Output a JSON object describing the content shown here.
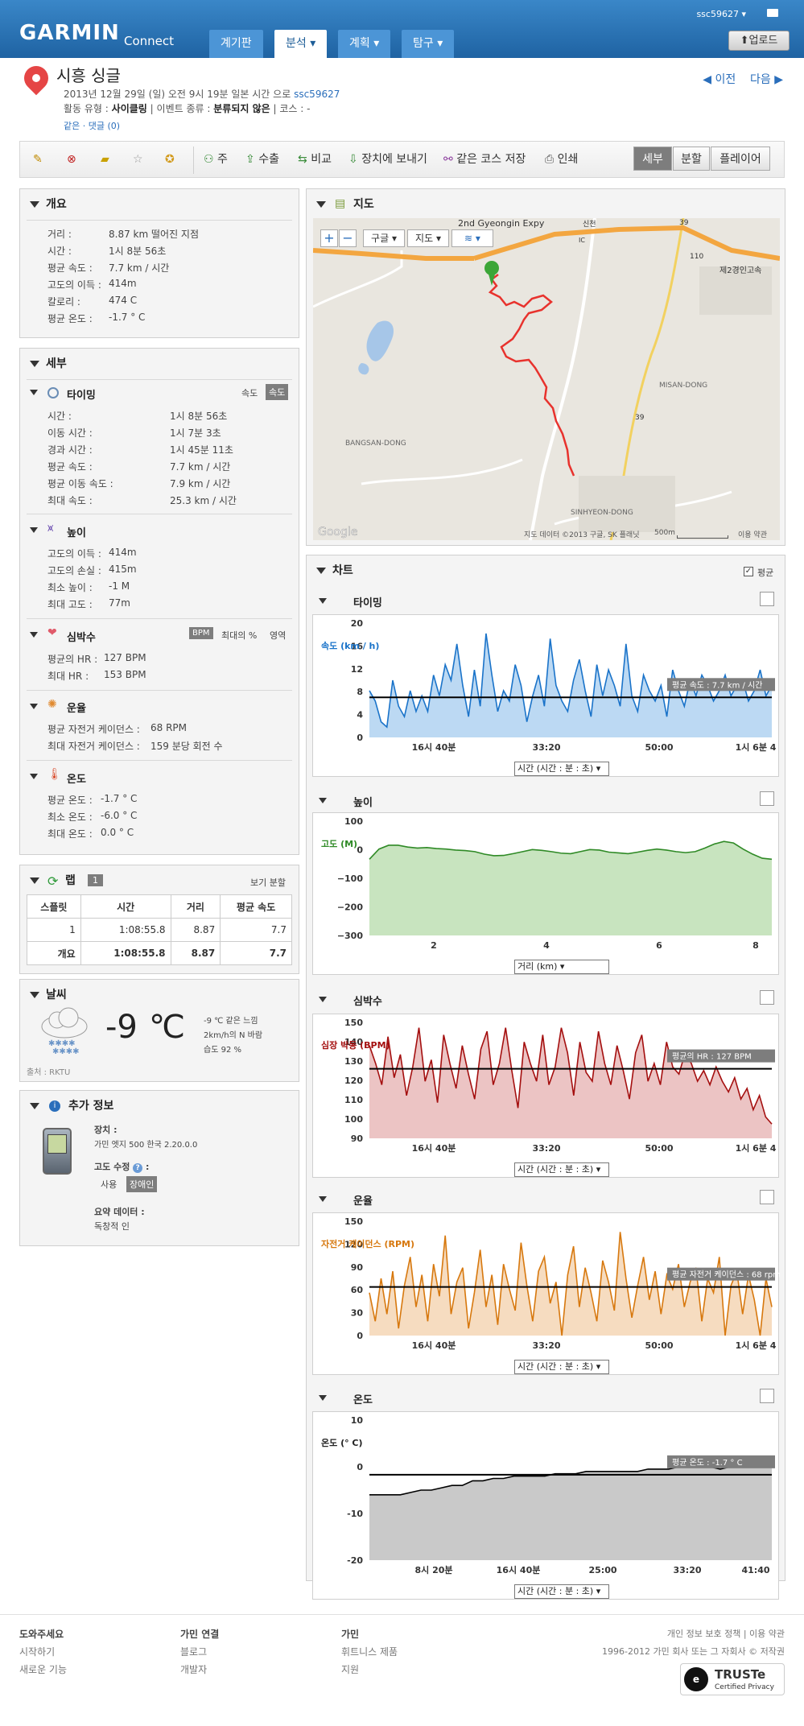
{
  "header": {
    "brand": "GARMIN",
    "brand_sub": "Connect",
    "username": "ssc59627",
    "tabs": [
      "계기판",
      "분석",
      "계획",
      "탐구"
    ],
    "upload_label": "업로드"
  },
  "activity": {
    "title": "시흥 싱글",
    "date_text": "2013년 12월 29일 (일) 오전 9시 19분 일본 시간 으로",
    "owner": "ssc59627",
    "type_label": "활동 유형 :",
    "type_value": "사이클링",
    "event_label": "| 이벤트 종류 :",
    "event_value": "분류되지 않은",
    "course_label": "| 코스 : -",
    "links": "같은 · 댓글 (0)",
    "prev": "이전",
    "next": "다음"
  },
  "toolbar": {
    "items": [
      "주",
      "수출",
      "비교",
      "장치에 보내기",
      "같은 코스 저장",
      "인쇄"
    ],
    "views": [
      "세부",
      "분할",
      "플레이어"
    ],
    "selected_view": "세부"
  },
  "overview": {
    "title": "개요",
    "rows": [
      {
        "label": "거리 :",
        "value": "8.87 km 떨어진 지점"
      },
      {
        "label": "시간 :",
        "value": "1시 8분 56초"
      },
      {
        "label": "평균 속도 :",
        "value": "7.7 km / 시간"
      },
      {
        "label": "고도의 이득 :",
        "value": "414m"
      },
      {
        "label": "칼로리 :",
        "value": "474 C"
      },
      {
        "label": "평균 온도 :",
        "value": "-1.7 ° C"
      }
    ]
  },
  "details": {
    "title": "세부",
    "timing": {
      "title": "타이밍",
      "toggle": [
        "속도",
        "속도"
      ],
      "rows": [
        {
          "label": "시간 :",
          "value": "1시 8분 56초"
        },
        {
          "label": "이동 시간 :",
          "value": "1시 7분 3초"
        },
        {
          "label": "경과 시간 :",
          "value": "1시 45분 11초"
        },
        {
          "label": "평균 속도 :",
          "value": "7.7 km / 시간"
        },
        {
          "label": "평균 이동 속도 :",
          "value": "7.9 km / 시간"
        },
        {
          "label": "최대 속도 :",
          "value": "25.3 km / 시간"
        }
      ]
    },
    "elevation": {
      "title": "높이",
      "rows": [
        {
          "label": "고도의 이득 :",
          "value": "414m"
        },
        {
          "label": "고도의 손실 :",
          "value": "415m"
        },
        {
          "label": "최소 높이 :",
          "value": "-1 M"
        },
        {
          "label": "최대 고도 :",
          "value": "77m"
        }
      ]
    },
    "heart": {
      "title": "심박수",
      "toggle": [
        "BPM",
        "최대의 %",
        "영역"
      ],
      "rows": [
        {
          "label": "평균의 HR :",
          "value": "127 BPM"
        },
        {
          "label": "최대 HR :",
          "value": "153 BPM"
        }
      ]
    },
    "cadence": {
      "title": "운율",
      "rows": [
        {
          "label": "평균 자전거 케이던스 :",
          "value": "68 RPM"
        },
        {
          "label": "최대 자전거 케이던스 :",
          "value": "159 분당 회전 수"
        }
      ]
    },
    "temperature": {
      "title": "온도",
      "rows": [
        {
          "label": "평균 온도 :",
          "value": "-1.7 ° C"
        },
        {
          "label": "최소 온도 :",
          "value": "-6.0 ° C"
        },
        {
          "label": "최대 온도 :",
          "value": "0.0 ° C"
        }
      ]
    }
  },
  "laps": {
    "title": "랩",
    "count": "1",
    "view_label": "보기 분할",
    "columns": [
      "스플릿",
      "시간",
      "거리",
      "평균 속도"
    ],
    "rows": [
      [
        "1",
        "1:08:55.8",
        "8.87",
        "7.7"
      ],
      [
        "개요",
        "1:08:55.8",
        "8.87",
        "7.7"
      ]
    ]
  },
  "weather": {
    "title": "날씨",
    "temp": "-9",
    "unit": "℃",
    "feels": "-9 ℃ 같은 느낌",
    "wind": "2km/h의 N 바람",
    "humidity": "습도 92 %",
    "source": "출처 : RKTU"
  },
  "extra": {
    "title": "추가 정보",
    "device_label": "장치 :",
    "device_value": "가민 엣지 500 한국 2.20.0.0",
    "elev_label": "고도 수정",
    "elev_toggle": [
      "사용",
      "장애인"
    ],
    "summary_label": "요약 데이터 :",
    "summary_value": "독창적 인"
  },
  "map": {
    "title": "지도",
    "controls": [
      "구글",
      "지도"
    ],
    "labels": [
      "2nd Gyeongin Expy",
      "제2경인고속",
      "MISAN-DONG",
      "BANGSAN-DONG",
      "SINHYEON-DONG",
      "Google",
      "IC",
      "신천",
      "110",
      "39",
      "39"
    ],
    "attribution": "지도 데이터 ©2013 구글, SK 플래닛",
    "scale": "500m",
    "terms": "이용 약관",
    "route_color": "#e8322d"
  },
  "charts_panel": {
    "title": "차트",
    "avg_toggle": "평균"
  },
  "charts": [
    {
      "key": "timing",
      "title": "타이밍",
      "type": "line",
      "ylabel": "속도 (km / h)",
      "yticks": [
        "20",
        "16",
        "12",
        "8",
        "4",
        "0"
      ],
      "xticks": [
        "16시 40분",
        "33:20",
        "50:00",
        "1시 6분 4"
      ],
      "xselect": "시간 (시간 : 분 : 초)",
      "avg_label": "평균 속도 : 7.7 km / 시간",
      "line_color": "#1a73c9",
      "fill_color": "#bcd9f3",
      "chart_data": {
        "type": "area",
        "x_range_min": [
          0,
          69
        ],
        "ylim": [
          0,
          22
        ],
        "avg": 7.7,
        "series_values": [
          9,
          7,
          3,
          2,
          11,
          6,
          4,
          9,
          5,
          8,
          5,
          12,
          8,
          14,
          11,
          18,
          10,
          4,
          13,
          6,
          20,
          12,
          5,
          9,
          7,
          14,
          10,
          3,
          8,
          12,
          6,
          19,
          10,
          7,
          5,
          11,
          15,
          9,
          4,
          14,
          8,
          13,
          10,
          6,
          18,
          8,
          5,
          12,
          9,
          7,
          10,
          4,
          13,
          9,
          6,
          11,
          8,
          12,
          10,
          7,
          9,
          12,
          8,
          10,
          11,
          7,
          9,
          13,
          8,
          10
        ]
      }
    },
    {
      "key": "elevation",
      "title": "높이",
      "type": "area",
      "ylabel": "고도 (M)",
      "yticks": [
        "100",
        "0",
        "−100",
        "−200",
        "−300"
      ],
      "xticks": [
        "2",
        "4",
        "6",
        "8"
      ],
      "xselect": "거리 (km)",
      "avg_label": "",
      "line_color": "#2f8a26",
      "fill_color": "#c8e4bf",
      "chart_data": {
        "type": "area",
        "x_range_km": [
          0,
          8.87
        ],
        "ylim": [
          -300,
          150
        ],
        "series_values": [
          0,
          40,
          55,
          55,
          48,
          44,
          46,
          42,
          40,
          36,
          34,
          30,
          20,
          14,
          15,
          22,
          30,
          38,
          35,
          30,
          24,
          22,
          30,
          38,
          36,
          28,
          25,
          22,
          28,
          35,
          40,
          36,
          30,
          26,
          30,
          44,
          60,
          70,
          64,
          40,
          20,
          4,
          0
        ]
      }
    },
    {
      "key": "heart",
      "title": "심박수",
      "type": "area",
      "ylabel": "심장 박동 (BPM)",
      "yticks": [
        "150",
        "140",
        "130",
        "120",
        "110",
        "100",
        "90"
      ],
      "xticks": [
        "16시 40분",
        "33:20",
        "50:00",
        "1시 6분 4"
      ],
      "xselect": "시간 (시간 : 분 : 초)",
      "avg_label": "평균의 HR : 127 BPM",
      "line_color": "#a40f0f",
      "fill_color": "#ecc4c4",
      "chart_data": {
        "type": "area",
        "ylim": [
          88,
          153
        ],
        "avg": 127,
        "series_values": [
          140,
          130,
          118,
          145,
          122,
          135,
          112,
          128,
          150,
          120,
          132,
          108,
          146,
          130,
          116,
          140,
          124,
          110,
          138,
          148,
          118,
          130,
          150,
          126,
          105,
          142,
          130,
          120,
          146,
          118,
          128,
          150,
          136,
          112,
          142,
          125,
          120,
          148,
          130,
          118,
          140,
          126,
          110,
          136,
          146,
          120,
          130,
          118,
          142,
          128,
          124,
          136,
          130,
          120,
          126,
          118,
          128,
          120,
          114,
          122,
          110,
          116,
          104,
          112,
          100,
          96
        ]
      }
    },
    {
      "key": "cadence",
      "title": "운율",
      "type": "area",
      "ylabel": "자전거 케이던스 (RPM)",
      "yticks": [
        "150",
        "120",
        "90",
        "60",
        "30",
        "0"
      ],
      "xticks": [
        "16시 40분",
        "33:20",
        "50:00",
        "1시 6분 4"
      ],
      "xselect": "시간 (시간 : 분 : 초)",
      "avg_label": "평균 자전거 케이던스 : 68 rpm",
      "line_color": "#d7780e",
      "fill_color": "#f6dcc0",
      "chart_data": {
        "type": "area",
        "ylim": [
          0,
          160
        ],
        "avg": 68,
        "series_values": [
          60,
          20,
          80,
          30,
          90,
          10,
          70,
          110,
          40,
          85,
          20,
          100,
          55,
          140,
          30,
          75,
          95,
          10,
          60,
          120,
          40,
          85,
          15,
          100,
          65,
          35,
          130,
          70,
          20,
          90,
          110,
          45,
          75,
          0,
          85,
          125,
          40,
          95,
          60,
          20,
          105,
          75,
          35,
          145,
          80,
          25,
          70,
          110,
          50,
          90,
          30,
          85,
          65,
          100,
          40,
          75,
          95,
          20,
          80,
          60,
          110,
          0,
          70,
          90,
          30,
          85,
          50,
          0,
          80,
          40
        ]
      }
    },
    {
      "key": "temperature",
      "title": "온도",
      "type": "area",
      "ylabel": "온도 (° C)",
      "yticks": [
        "10",
        "0",
        "-10",
        "-20"
      ],
      "xticks": [
        "8시 20분",
        "16시 40분",
        "25:00",
        "33:20",
        "41:40"
      ],
      "xselect": "시간 (시간 : 분 : 초)",
      "avg_label": "평균 온도 : -1.7 ° C",
      "line_color": "#000000",
      "fill_color": "#c9c9c9",
      "chart_data": {
        "type": "area",
        "ylim": [
          -20,
          10
        ],
        "avg": -1.7,
        "series_values": [
          -6,
          -6,
          -6,
          -6,
          -5.5,
          -5,
          -5,
          -4.5,
          -4,
          -4,
          -3,
          -3,
          -2.5,
          -2.5,
          -2,
          -2,
          -2,
          -2,
          -1.5,
          -1.5,
          -1.5,
          -1,
          -1,
          -1,
          -1,
          -1,
          -1,
          -0.5,
          -0.5,
          -0.5,
          0,
          0,
          0,
          0,
          -0.5,
          0,
          0,
          0,
          0,
          0
        ]
      }
    }
  ],
  "footer": {
    "col1_title": "도와주세요",
    "col1_items": [
      "시작하기",
      "새로운 기능"
    ],
    "col2_title": "가민 연결",
    "col2_items": [
      "블로그",
      "개발자"
    ],
    "col3_title": "가민",
    "col3_items": [
      "휘트니스 제품",
      "지원"
    ],
    "right_links": "개인 정보 보호 정책 | 이용 약관",
    "copyright": "1996-2012 가민 회사 또는 그 자회사 © 저작권",
    "truste": "TRUSTe",
    "truste_sub": "Certified Privacy"
  }
}
